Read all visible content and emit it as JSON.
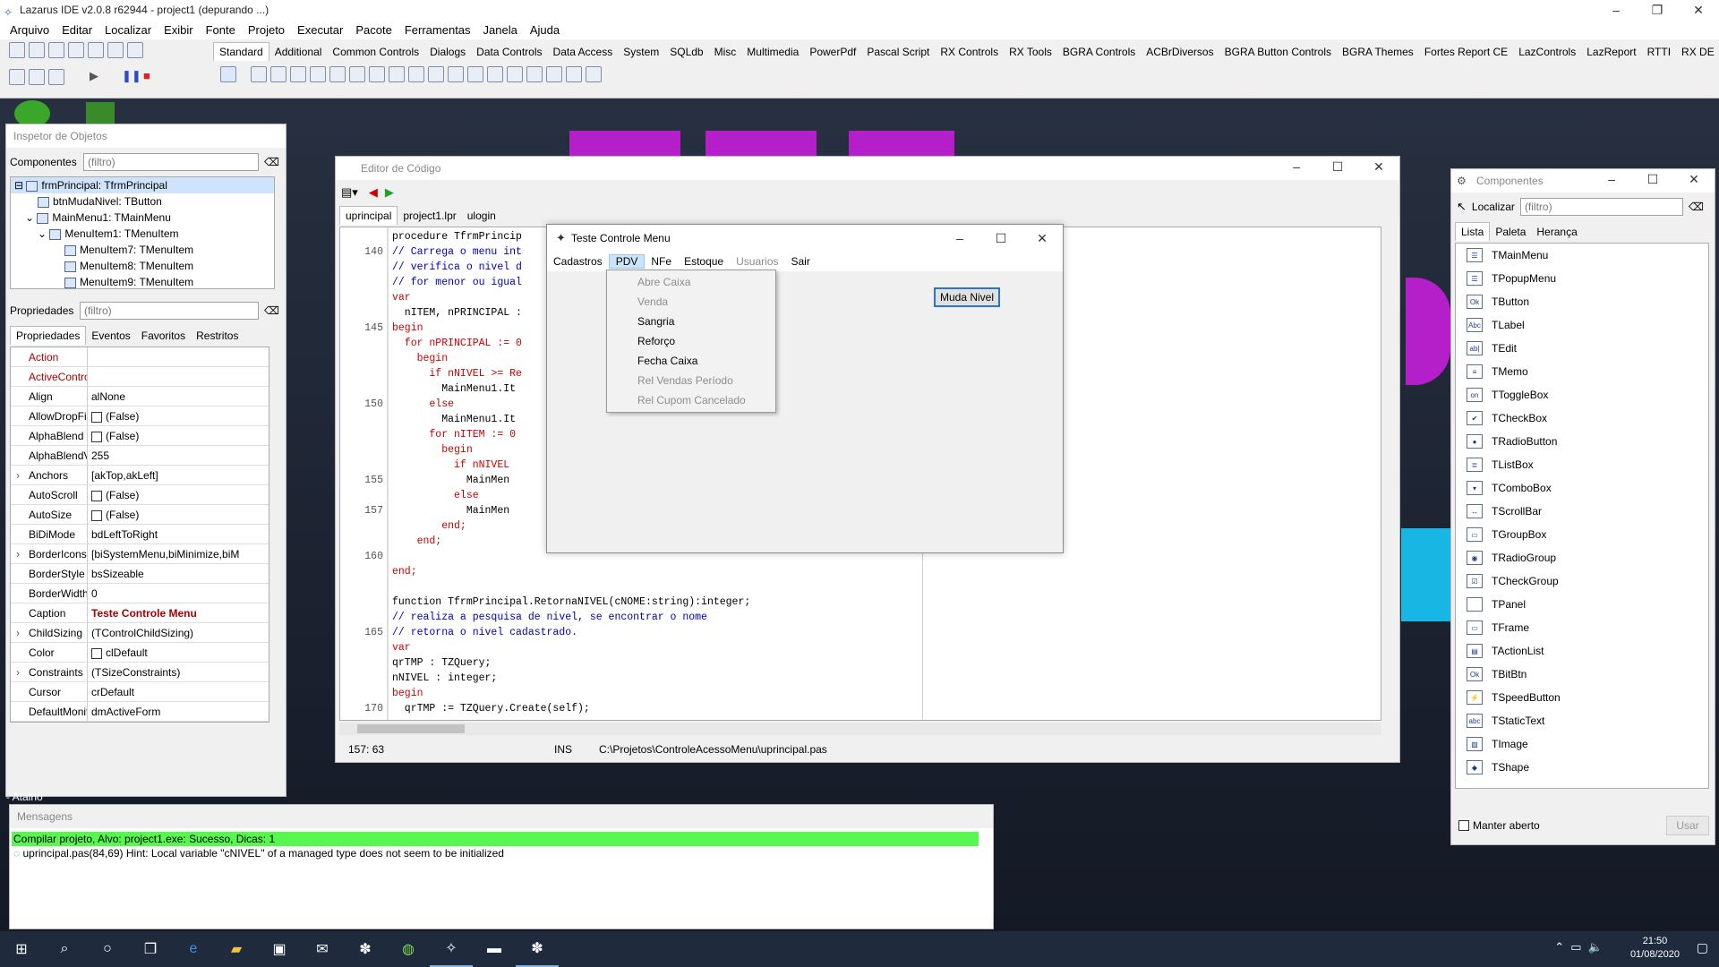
{
  "window": {
    "title": "Lazarus IDE v2.0.8 r62944 - project1 (depurando ...)"
  },
  "menu": [
    "Arquivo",
    "Editar",
    "Localizar",
    "Exibir",
    "Fonte",
    "Projeto",
    "Executar",
    "Pacote",
    "Ferramentas",
    "Janela",
    "Ajuda"
  ],
  "palette_tabs": [
    "Standard",
    "Additional",
    "Common Controls",
    "Dialogs",
    "Data Controls",
    "Data Access",
    "System",
    "SQLdb",
    "Misc",
    "Multimedia",
    "PowerPdf",
    "Pascal Script",
    "RX Controls",
    "RX Tools",
    "BGRA Controls",
    "ACBrDiversos",
    "BGRA Button Controls",
    "BGRA Themes",
    "Fortes Report CE",
    "LazControls",
    "LazReport",
    "RTTI",
    "RX DE"
  ],
  "inspector": {
    "title": "Inspetor de Objetos",
    "components_label": "Componentes",
    "filter": "(filtro)",
    "tree": [
      "frmPrincipal: TfrmPrincipal",
      "btnMudaNivel: TButton",
      "MainMenu1: TMainMenu",
      "MenuItem1: TMenuItem",
      "MenuItem7: TMenuItem",
      "MenuItem8: TMenuItem",
      "MenuItem9: TMenuItem"
    ],
    "properties_label": "Propriedades",
    "tabs": [
      "Propriedades",
      "Eventos",
      "Favoritos",
      "Restritos"
    ],
    "props": [
      {
        "n": "Action",
        "v": ""
      },
      {
        "n": "ActiveControl",
        "v": ""
      },
      {
        "n": "Align",
        "v": "alNone"
      },
      {
        "n": "AllowDropFiles",
        "v": "(False)"
      },
      {
        "n": "AlphaBlend",
        "v": "(False)"
      },
      {
        "n": "AlphaBlendValu",
        "v": "255"
      },
      {
        "n": "Anchors",
        "v": "[akTop,akLeft]"
      },
      {
        "n": "AutoScroll",
        "v": "(False)"
      },
      {
        "n": "AutoSize",
        "v": "(False)"
      },
      {
        "n": "BiDiMode",
        "v": "bdLeftToRight"
      },
      {
        "n": "BorderIcons",
        "v": "[biSystemMenu,biMinimize,biM"
      },
      {
        "n": "BorderStyle",
        "v": "bsSizeable"
      },
      {
        "n": "BorderWidth",
        "v": "0"
      },
      {
        "n": "Caption",
        "v": "Teste Controle Menu"
      },
      {
        "n": "ChildSizing",
        "v": "(TControlChildSizing)"
      },
      {
        "n": "Color",
        "v": "clDefault"
      },
      {
        "n": "Constraints",
        "v": "(TSizeConstraints)"
      },
      {
        "n": "Cursor",
        "v": "crDefault"
      },
      {
        "n": "DefaultMonitor",
        "v": "dmActiveForm"
      }
    ],
    "footer": "- Atalho"
  },
  "editor": {
    "title": "Editor de Código",
    "tabs": [
      "uprincipal",
      "project1.lpr",
      "ulogin"
    ],
    "lines": [
      {
        "n": "",
        "t": "procedure TfrmPrincip"
      },
      {
        "n": "140",
        "t": "// Carrega o menu int"
      },
      {
        "n": "",
        "t": "// verifica o nivel d"
      },
      {
        "n": "",
        "t": "// for menor ou igual"
      },
      {
        "n": "",
        "t": "var"
      },
      {
        "n": "",
        "t": "  nITEM, nPRINCIPAL :"
      },
      {
        "n": "145",
        "t": "begin"
      },
      {
        "n": "",
        "t": "  for nPRINCIPAL := 0"
      },
      {
        "n": "",
        "t": "    begin"
      },
      {
        "n": "",
        "t": "      if nNIVEL >= Re"
      },
      {
        "n": "",
        "t": "        MainMenu1.It"
      },
      {
        "n": "150",
        "t": "      else"
      },
      {
        "n": "",
        "t": "        MainMenu1.It"
      },
      {
        "n": "",
        "t": "      for nITEM := 0"
      },
      {
        "n": "",
        "t": "        begin"
      },
      {
        "n": "",
        "t": "          if nNIVEL"
      },
      {
        "n": "155",
        "t": "            MainMen"
      },
      {
        "n": "",
        "t": "          else"
      },
      {
        "n": "157",
        "t": "            MainMen"
      },
      {
        "n": "",
        "t": "        end;"
      },
      {
        "n": "",
        "t": "    end;"
      },
      {
        "n": "160",
        "t": ""
      },
      {
        "n": "",
        "t": "end;"
      },
      {
        "n": "",
        "t": ""
      },
      {
        "n": "",
        "t": "function TfrmPrincipal.RetornaNIVEL(cNOME:string):integer;"
      },
      {
        "n": "",
        "t": "// realiza a pesquisa de nivel, se encontrar o nome"
      },
      {
        "n": "165",
        "t": "// retorna o nivel cadastrado."
      },
      {
        "n": "",
        "t": "var"
      },
      {
        "n": "",
        "t": "qrTMP : TZQuery;"
      },
      {
        "n": "",
        "t": "nNIVEL : integer;"
      },
      {
        "n": "",
        "t": "begin"
      },
      {
        "n": "170",
        "t": "  qrTMP := TZQuery.Create(self);"
      }
    ],
    "status": {
      "pos": "157: 63",
      "mode": "INS",
      "file": "C:\\Projetos\\ControleAcessoMenu\\uprincipal.pas"
    }
  },
  "dialog": {
    "title": "Teste Controle Menu",
    "menu": [
      "Cadastros",
      "PDV",
      "NFe",
      "Estoque",
      "Usuarios",
      "Sair"
    ],
    "dropdown": [
      {
        "label": "Abre Caixa",
        "enabled": false
      },
      {
        "label": "Venda",
        "enabled": false
      },
      {
        "label": "Sangria",
        "enabled": true
      },
      {
        "label": "Reforço",
        "enabled": true
      },
      {
        "label": "Fecha Caixa",
        "enabled": true
      },
      {
        "label": "Rel Vendas Período",
        "enabled": false
      },
      {
        "label": "Rel Cupom Cancelado",
        "enabled": false
      }
    ],
    "button": "Muda Nivel"
  },
  "components": {
    "title": "Componentes",
    "find_label": "Localizar",
    "filter": "(filtro)",
    "tabs": [
      "Lista",
      "Paleta",
      "Herança"
    ],
    "items": [
      {
        "name": "TMainMenu",
        "icon": "☰"
      },
      {
        "name": "TPopupMenu",
        "icon": "☰"
      },
      {
        "name": "TButton",
        "icon": "Ok"
      },
      {
        "name": "TLabel",
        "icon": "Abc"
      },
      {
        "name": "TEdit",
        "icon": "ab|"
      },
      {
        "name": "TMemo",
        "icon": "≡"
      },
      {
        "name": "TToggleBox",
        "icon": "on"
      },
      {
        "name": "TCheckBox",
        "icon": "✔"
      },
      {
        "name": "TRadioButton",
        "icon": "●"
      },
      {
        "name": "TListBox",
        "icon": "≣"
      },
      {
        "name": "TComboBox",
        "icon": "▾"
      },
      {
        "name": "TScrollBar",
        "icon": "↔"
      },
      {
        "name": "TGroupBox",
        "icon": "▭"
      },
      {
        "name": "TRadioGroup",
        "icon": "◉"
      },
      {
        "name": "TCheckGroup",
        "icon": "☑"
      },
      {
        "name": "TPanel",
        "icon": ""
      },
      {
        "name": "TFrame",
        "icon": "▭"
      },
      {
        "name": "TActionList",
        "icon": "▤"
      },
      {
        "name": "TBitBtn",
        "icon": "Ok"
      },
      {
        "name": "TSpeedButton",
        "icon": "⚡"
      },
      {
        "name": "TStaticText",
        "icon": "abc"
      },
      {
        "name": "TImage",
        "icon": "▨"
      },
      {
        "name": "TShape",
        "icon": "◆"
      }
    ],
    "keep_open": "Manter aberto",
    "use_button": "Usar"
  },
  "messages": {
    "title": "Mensagens",
    "success": "Compilar projeto, Alvo: project1.exe: Sucesso, Dicas: 1",
    "hint": "uprincipal.pas(84,69) Hint: Local variable \"cNIVEL\" of a managed type does not seem to be initialized"
  },
  "taskbar": {
    "time": "21:50",
    "date": "01/08/2020"
  },
  "colors": {
    "accent": "#b51fc9",
    "success": "#57f74f",
    "teal": "#18b7e3"
  }
}
